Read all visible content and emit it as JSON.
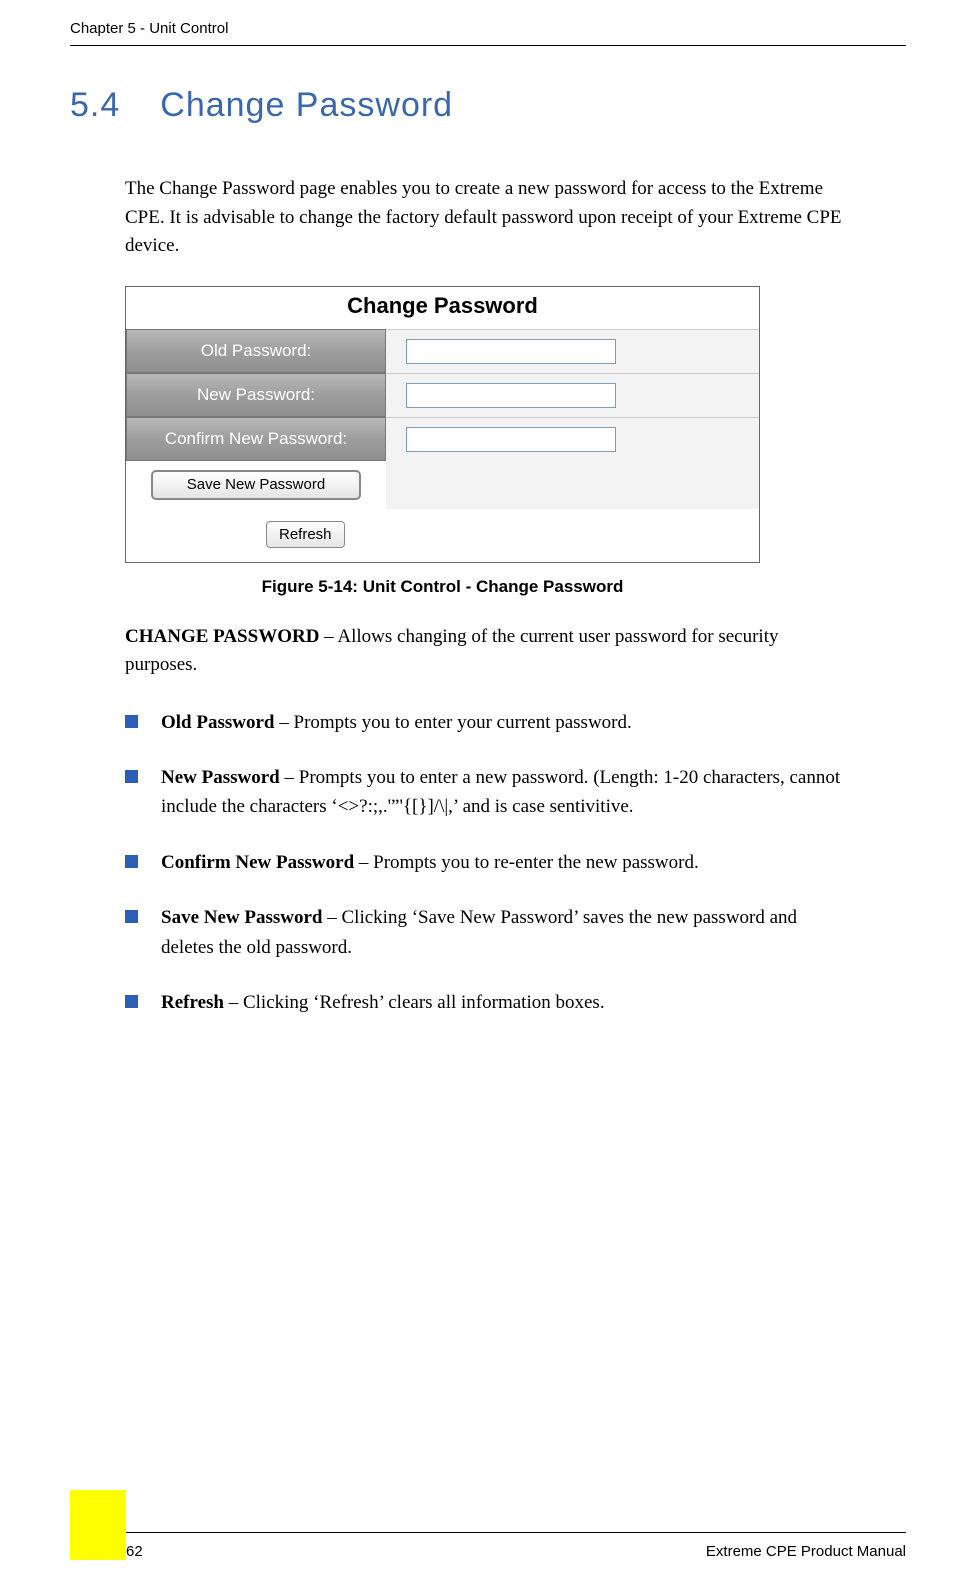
{
  "chapter": "Chapter 5 - Unit Control",
  "section": {
    "number": "5.4",
    "title": "Change Password"
  },
  "intro": "The Change Password page enables you to create a new password for access to the Extreme CPE. It is advisable to change the factory default password upon receipt of your Extreme CPE device.",
  "widget": {
    "title": "Change Password",
    "labels": {
      "old": "Old Password:",
      "new": "New Password:",
      "confirm": "Confirm New Password:"
    },
    "buttons": {
      "save": "Save New Password",
      "refresh": "Refresh"
    }
  },
  "caption": "Figure 5-14: Unit Control - Change Password",
  "lede": {
    "head": "CHANGE PASSWORD",
    "body": " – Allows changing of the current user password for security purposes."
  },
  "bullets": [
    {
      "head": "Old Password",
      "body": " – Prompts you to enter your current password."
    },
    {
      "head": "New Password",
      "body": " – Prompts you to enter a new password. (Length: 1-20 characters, cannot include the characters ‘<>?:;,.'”'{[}]/\\|,’ and is case sentivitive."
    },
    {
      "head": "Confirm New Password",
      "body": " – Prompts you to re-enter the new password."
    },
    {
      "head": "Save New Password",
      "body": " – Clicking ‘Save New Password’ saves the new password and deletes the old password."
    },
    {
      "head": "Refresh",
      "body": " – Clicking ‘Refresh’ clears all information boxes."
    }
  ],
  "footer": {
    "page": "62",
    "manual": "Extreme CPE Product Manual"
  }
}
